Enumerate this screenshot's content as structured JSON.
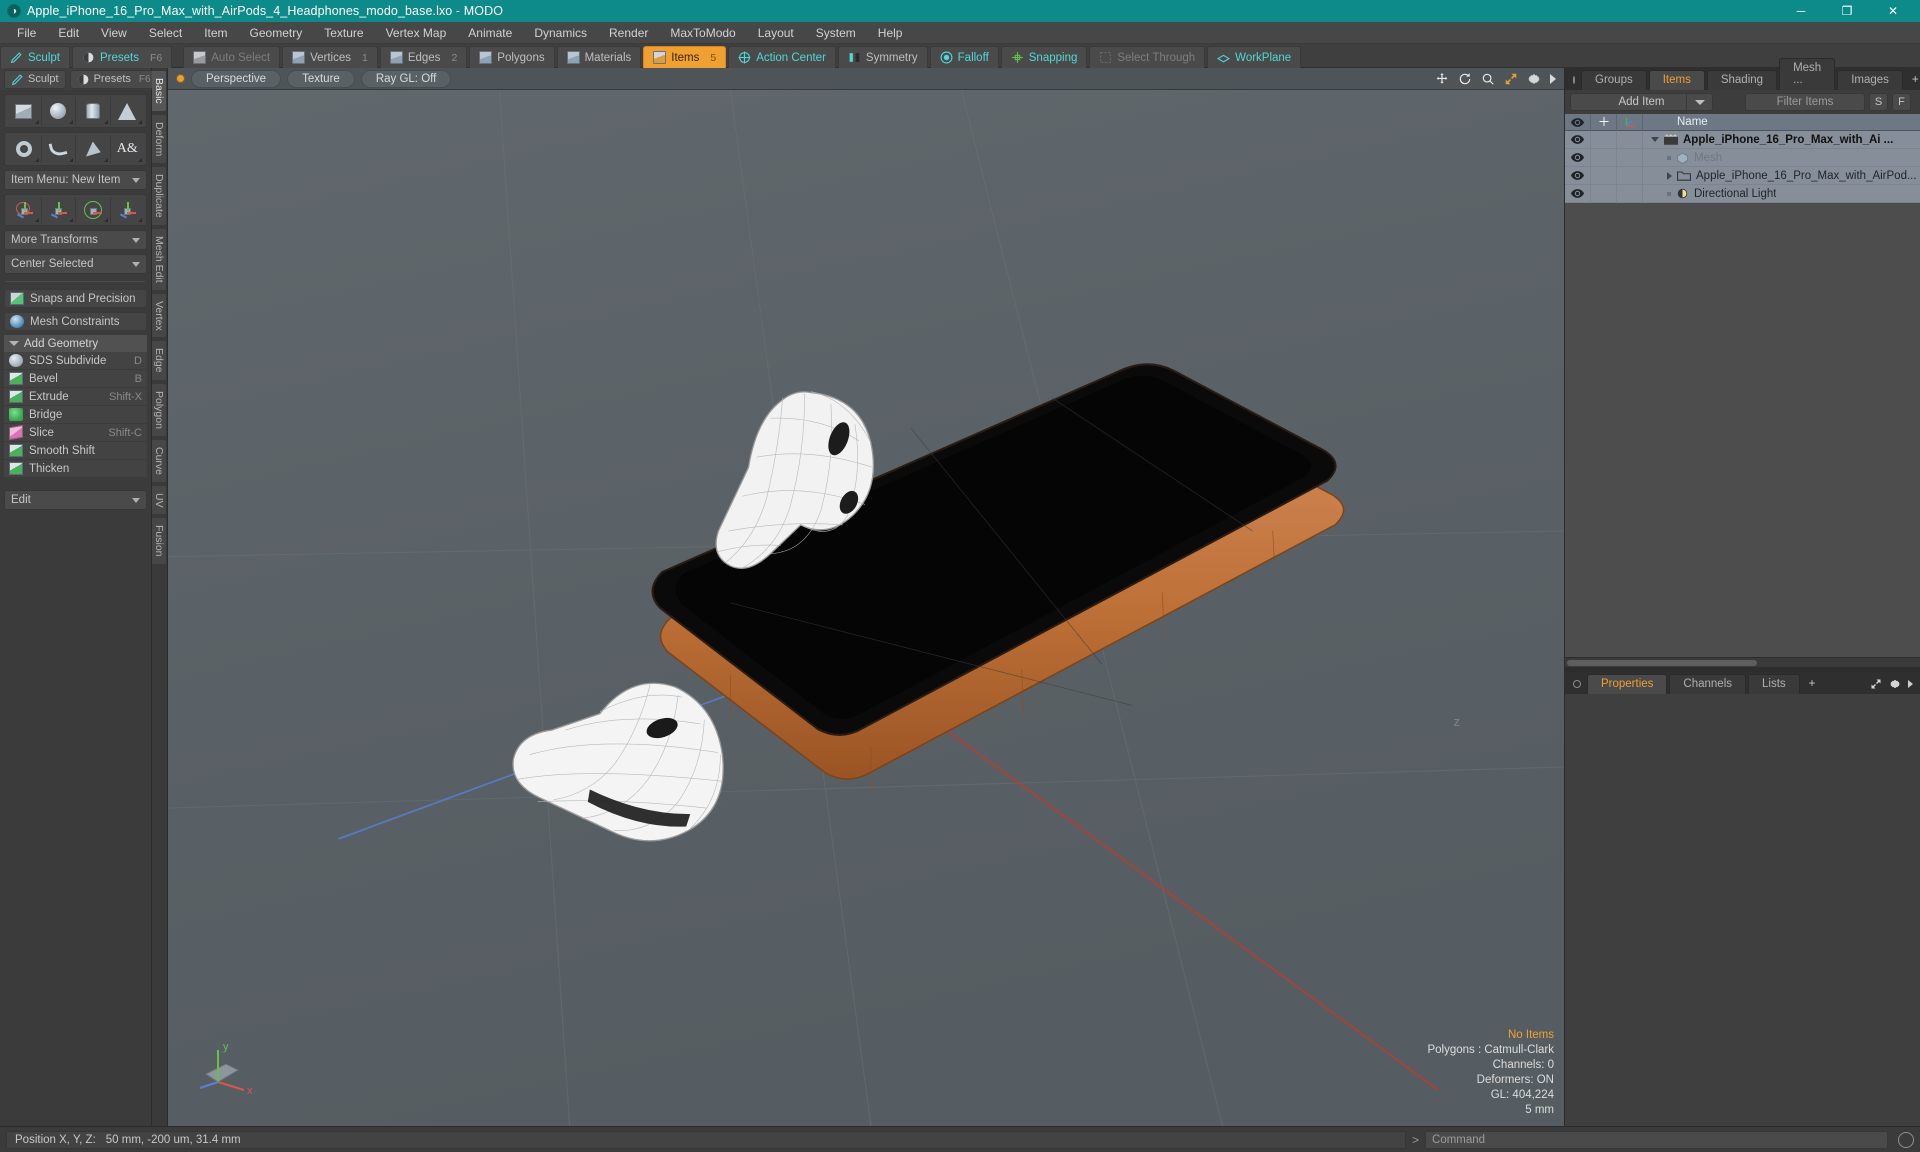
{
  "titlebar": {
    "title": "Apple_iPhone_16_Pro_Max_with_AirPods_4_Headphones_modo_base.lxo - MODO",
    "logo": "modo-logo-icon",
    "minimize": "─",
    "maximize": "❐",
    "close": "✕"
  },
  "menubar": {
    "items": [
      "File",
      "Edit",
      "View",
      "Select",
      "Item",
      "Geometry",
      "Texture",
      "Vertex Map",
      "Animate",
      "Dynamics",
      "Render",
      "MaxToModo",
      "Layout",
      "System",
      "Help"
    ]
  },
  "toolbar": {
    "left_group": [
      {
        "label": "Sculpt",
        "icon": "sculpt-icon",
        "style": "teal"
      },
      {
        "label": "Presets",
        "icon": "presets-icon",
        "style": "teal",
        "shortcut": "F6"
      }
    ],
    "mode_group": [
      {
        "label": "Auto Select",
        "icon": "cube-gray-icon",
        "style": "dim",
        "shortcut": ""
      },
      {
        "label": "Vertices",
        "icon": "cube-icon",
        "style": "normal",
        "shortcut": "1"
      },
      {
        "label": "Edges",
        "icon": "cube-icon",
        "style": "normal",
        "shortcut": "2"
      },
      {
        "label": "Polygons",
        "icon": "cube-icon",
        "style": "normal",
        "shortcut": ""
      },
      {
        "label": "Materials",
        "icon": "cube-icon",
        "style": "normal",
        "shortcut": ""
      },
      {
        "label": "Items",
        "icon": "cube-orange-icon",
        "style": "active",
        "shortcut": "5"
      },
      {
        "label": "Action Center",
        "icon": "action-center-icon",
        "style": "teal",
        "shortcut": ""
      },
      {
        "label": "Symmetry",
        "icon": "symmetry-icon",
        "style": "normal",
        "shortcut": ""
      },
      {
        "label": "Falloff",
        "icon": "falloff-icon",
        "style": "teal",
        "shortcut": ""
      },
      {
        "label": "Snapping",
        "icon": "snapping-icon",
        "style": "teal",
        "shortcut": ""
      },
      {
        "label": "Select Through",
        "icon": "select-through-icon",
        "style": "dim",
        "shortcut": ""
      },
      {
        "label": "WorkPlane",
        "icon": "workplane-icon",
        "style": "teal",
        "shortcut": ""
      }
    ]
  },
  "left_panel": {
    "header": [
      {
        "label": "Sculpt",
        "icon": "sculpt-icon"
      },
      {
        "label": "Presets",
        "icon": "presets-icon",
        "shortcut": "F6"
      }
    ],
    "primitives_row1": [
      {
        "name": "cube-primitive",
        "icon": "cube-shape"
      },
      {
        "name": "sphere-primitive",
        "icon": "sphere-shape"
      },
      {
        "name": "cylinder-primitive",
        "icon": "cylinder-shape"
      },
      {
        "name": "cone-primitive",
        "icon": "cone-shape"
      }
    ],
    "primitives_row2": [
      {
        "name": "torus-primitive",
        "icon": "torus-shape"
      },
      {
        "name": "curve-tool",
        "icon": "curve-shape"
      },
      {
        "name": "polygon-tool",
        "icon": "polygon-shape"
      },
      {
        "name": "text-tool",
        "icon": "text-shape",
        "glyph": "A&"
      }
    ],
    "item_menu": "Item Menu: New Item",
    "transforms": [
      {
        "name": "move-tool",
        "icon": "move-gizmo-icon"
      },
      {
        "name": "scale-tool",
        "icon": "scale-gizmo-icon"
      },
      {
        "name": "rotate-tool",
        "icon": "rotate-gizmo-icon"
      },
      {
        "name": "transform-tool",
        "icon": "transform-gizmo-icon"
      }
    ],
    "more_transforms": "More Transforms",
    "center_selected": "Center Selected",
    "snaps": {
      "label": "Snaps and Precision",
      "icon": "snap-arrow-icon"
    },
    "mesh_constraints": {
      "label": "Mesh Constraints",
      "icon": "mesh-constraint-icon"
    },
    "add_geometry_header": "Add Geometry",
    "geometry_tools": [
      {
        "label": "SDS Subdivide",
        "shortcut": "D",
        "icon": "sds-subdivide-icon"
      },
      {
        "label": "Bevel",
        "shortcut": "B",
        "icon": "bevel-icon"
      },
      {
        "label": "Extrude",
        "shortcut": "Shift-X",
        "icon": "extrude-icon"
      },
      {
        "label": "Bridge",
        "shortcut": "",
        "icon": "bridge-icon"
      },
      {
        "label": "Slice",
        "shortcut": "Shift-C",
        "icon": "slice-icon"
      },
      {
        "label": "Smooth Shift",
        "shortcut": "",
        "icon": "smooth-shift-icon"
      },
      {
        "label": "Thicken",
        "shortcut": "",
        "icon": "thicken-icon"
      }
    ],
    "edit_dropdown": "Edit",
    "vertical_tabs": [
      "Basic",
      "Deform",
      "Duplicate",
      "Mesh Edit",
      "Vertex",
      "Edge",
      "Polygon",
      "Curve",
      "UV",
      "Fusion"
    ],
    "vertical_tab_selected": "Basic"
  },
  "viewport": {
    "header_dot": "viewport-active-dot",
    "chips": [
      "Perspective",
      "Texture",
      "Ray GL: Off"
    ],
    "nav_icons": [
      "pan-icon",
      "rotate-icon",
      "zoom-icon",
      "fit-icon",
      "gear-icon",
      "chevron-right-icon"
    ],
    "stats": {
      "items": "No Items",
      "polygons": "Polygons : Catmull-Clark",
      "channels": "Channels: 0",
      "deformers": "Deformers: ON",
      "gl": "GL: 404,224",
      "grid": "5 mm"
    },
    "axis_labels": {
      "x": "x",
      "y": "y",
      "z": "z"
    }
  },
  "right_panel": {
    "tabs": [
      "Groups",
      "Items",
      "Shading",
      "Mesh ...",
      "Images"
    ],
    "tab_selected": "Items",
    "tab_add": "+",
    "tools": [
      "expand-icon",
      "gear-icon",
      "chevron-right-icon"
    ],
    "add_item": "Add Item",
    "filter_placeholder": "Filter Items",
    "filter_value": "Filter Items",
    "btn_s": "S",
    "btn_f": "F",
    "columns": {
      "eye": "visibility-icon",
      "lock": "lock-icon",
      "axis": "axis-icon",
      "name": "Name"
    },
    "items": [
      {
        "name": "Apple_iPhone_16_Pro_Max_with_Ai ...",
        "icon": "scene-icon",
        "depth": 0,
        "expander": "down",
        "bold": true,
        "dim": false
      },
      {
        "name": "Mesh",
        "icon": "mesh-icon",
        "depth": 1,
        "expander": "none",
        "bold": false,
        "dim": true
      },
      {
        "name": "Apple_iPhone_16_Pro_Max_with_AirPod...",
        "icon": "folder-icon",
        "depth": 1,
        "expander": "right",
        "bold": false,
        "dim": false
      },
      {
        "name": "Directional Light",
        "icon": "light-icon",
        "depth": 1,
        "expander": "none",
        "bold": false,
        "dim": false
      }
    ]
  },
  "properties_panel": {
    "tabs": [
      "Properties",
      "Channels",
      "Lists"
    ],
    "tab_selected": "Properties",
    "tab_add": "+",
    "tools": [
      "expand-icon",
      "gear-icon",
      "chevron-right-icon"
    ]
  },
  "bottom_bar": {
    "position_label": "Position X, Y, Z:",
    "position_value": "50 mm, -200 um, 31.4 mm",
    "command_prompt": ">",
    "command_placeholder": "Command",
    "command_value": "Command"
  },
  "colors": {
    "title_bg": "#0d8b8b",
    "accent": "#f0a030",
    "teal_text": "#4fd8d8",
    "viewport_bg": "#5a6166",
    "item_list_bg": "#868f99",
    "axis_x": "#d9564f",
    "axis_y": "#63c24a",
    "axis_z": "#5a7fd6",
    "phone_body": "#c4783f",
    "phone_screen": "#0a0a0a"
  }
}
